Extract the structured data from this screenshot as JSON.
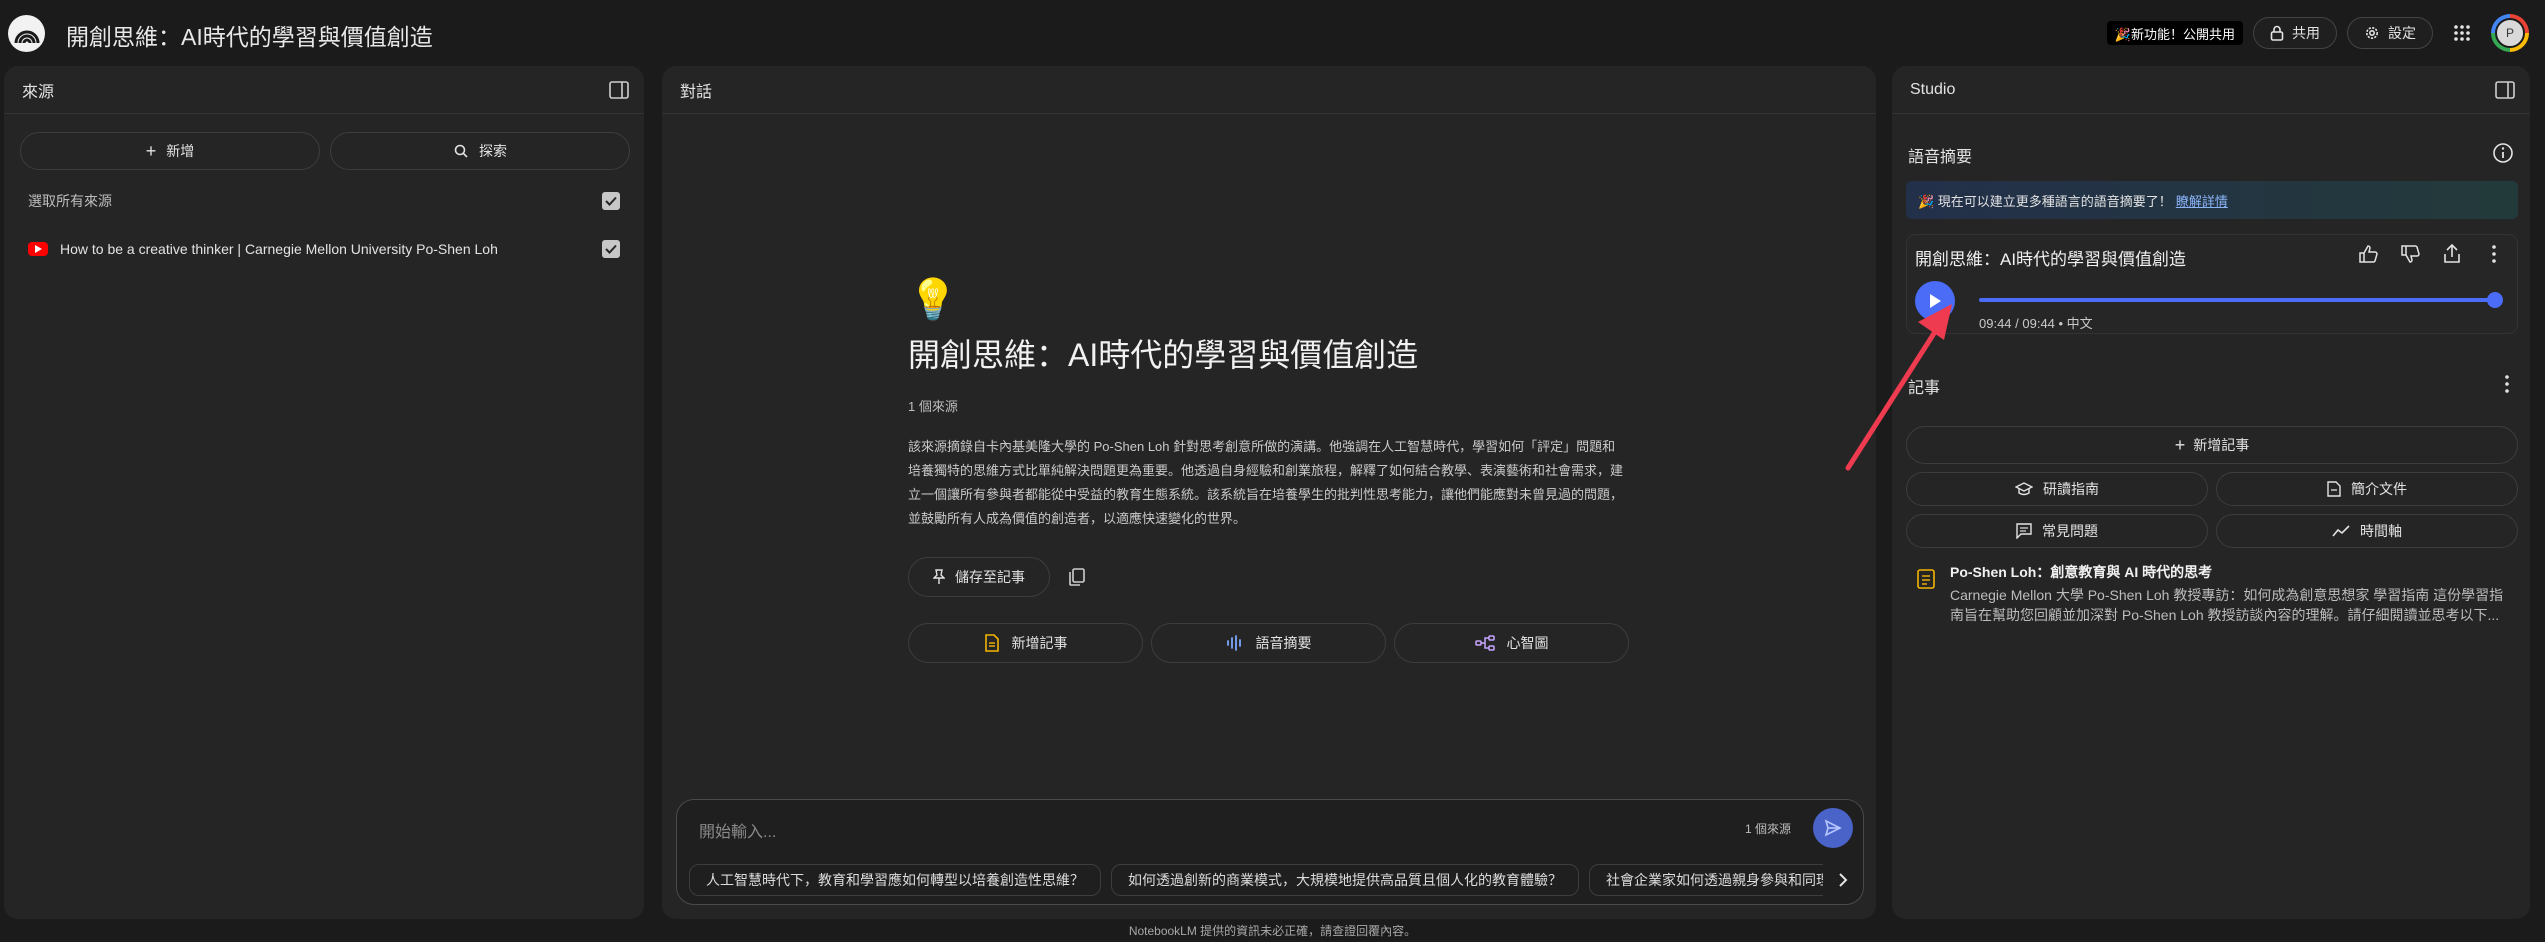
{
  "header": {
    "title": "開創思維：AI時代的學習與價值創造",
    "new_feature_badge": "🎉新功能！公開共用",
    "share_label": "共用",
    "settings_label": "設定",
    "avatar_initial": "P"
  },
  "sources_panel": {
    "title": "來源",
    "add_label": "新增",
    "explore_label": "探索",
    "select_all_label": "選取所有來源",
    "sources": [
      {
        "title": "How to be a creative thinker | Carnegie Mellon University Po-Shen Loh"
      }
    ]
  },
  "chat_panel": {
    "title": "對話",
    "notebook_emoji": "💡",
    "notebook_title": "開創思維：AI時代的學習與價值創造",
    "source_count": "1 個來源",
    "summary": "該來源摘錄自卡內基美隆大學的 Po-Shen Loh 針對思考創意所做的演講。他強調在人工智慧時代，學習如何「評定」問題和培養獨特的思維方式比單純解決問題更為重要。他透過自身經驗和創業旅程，解釋了如何結合教學、表演藝術和社會需求，建立一個讓所有參與者都能從中受益的教育生態系統。該系統旨在培養學生的批判性思考能力，讓他們能應對未曾見過的問題，並鼓勵所有人成為價值的創造者，以適應快速變化的世界。",
    "save_to_note_label": "儲存至記事",
    "quick_actions": [
      {
        "label": "新增記事"
      },
      {
        "label": "語音摘要"
      },
      {
        "label": "心智圖"
      }
    ],
    "input_placeholder": "開始輸入...",
    "input_source_count": "1 個來源",
    "suggestions": [
      "人工智慧時代下，教育和學習應如何轉型以培養創造性思維？",
      "如何透過創新的商業模式，大規模地提供高品質且個人化的教育體驗？",
      "社會企業家如何透過親身參與和同理心"
    ]
  },
  "studio_panel": {
    "title": "Studio",
    "audio_section_label": "語音摘要",
    "banner_text": "🎉 現在可以建立更多種語言的語音摘要了！",
    "banner_link": "瞭解詳情",
    "audio": {
      "title": "開創思維：AI時代的學習與價值創造",
      "time": "09:44 / 09:44 • 中文",
      "progress": 1.0
    },
    "notes_section_label": "記事",
    "add_note_label": "新增記事",
    "note_buttons": [
      {
        "label": "研讀指南"
      },
      {
        "label": "簡介文件"
      },
      {
        "label": "常見問題"
      },
      {
        "label": "時間軸"
      }
    ],
    "notes": [
      {
        "title": "Po-Shen Loh：創意教育與 AI 時代的思考",
        "snippet": "Carnegie Mellon 大學 Po-Shen Loh 教授專訪：如何成為創意思想家 學習指南 這份學習指南旨在幫助您回顧並加深對 Po-Shen Loh 教授訪談內容的理解。請仔細閱讀並思考以下..."
      }
    ]
  },
  "footer": {
    "disclaimer": "NotebookLM 提供的資訊未必正確，請查證回覆內容。"
  },
  "colors": {
    "background": "#1b1b1c",
    "panel": "#252526",
    "accent_blue": "#4a6cf7",
    "annotation_arrow": "#ef3b4f"
  }
}
